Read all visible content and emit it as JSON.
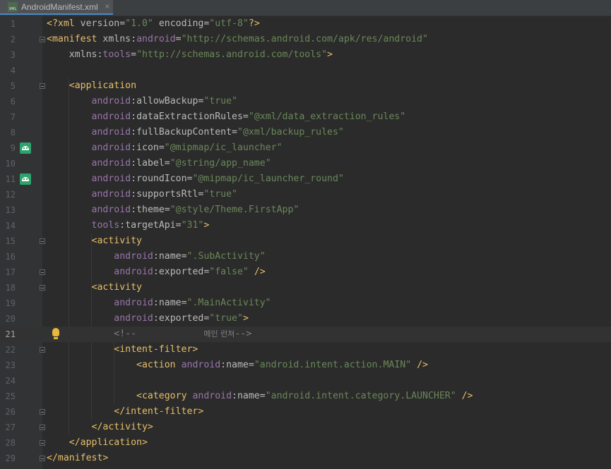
{
  "tab": {
    "icon_text": "XML",
    "filename": "AndroidManifest.xml",
    "close": "×"
  },
  "current_line": 21,
  "lines": [
    {
      "n": "1",
      "parts": [
        [
          "tag",
          "<?xml "
        ],
        [
          "att",
          "version"
        ],
        [
          "pnc",
          "="
        ],
        [
          "val",
          "\"1.0\""
        ],
        [
          "att",
          " encoding"
        ],
        [
          "pnc",
          "="
        ],
        [
          "val",
          "\"utf-8\""
        ],
        [
          "tag",
          "?>"
        ]
      ]
    },
    {
      "n": "2",
      "parts": [
        [
          "tag",
          "<manifest "
        ],
        [
          "att",
          "xmlns"
        ],
        [
          "pnc",
          ":"
        ],
        [
          "nsp",
          "android"
        ],
        [
          "pnc",
          "="
        ],
        [
          "val",
          "\"http://schemas.android.com/apk/res/android\""
        ]
      ]
    },
    {
      "n": "3",
      "parts": [
        [
          "pnc",
          "    "
        ],
        [
          "att",
          "xmlns"
        ],
        [
          "pnc",
          ":"
        ],
        [
          "nsp",
          "tools"
        ],
        [
          "pnc",
          "="
        ],
        [
          "val",
          "\"http://schemas.android.com/tools\""
        ],
        [
          "tag",
          ">"
        ]
      ]
    },
    {
      "n": "4",
      "parts": []
    },
    {
      "n": "5",
      "parts": [
        [
          "pnc",
          "    "
        ],
        [
          "tag",
          "<application"
        ]
      ]
    },
    {
      "n": "6",
      "parts": [
        [
          "pnc",
          "        "
        ],
        [
          "nsp",
          "android"
        ],
        [
          "pnc",
          ":"
        ],
        [
          "att",
          "allowBackup"
        ],
        [
          "pnc",
          "="
        ],
        [
          "val",
          "\"true\""
        ]
      ]
    },
    {
      "n": "7",
      "parts": [
        [
          "pnc",
          "        "
        ],
        [
          "nsp",
          "android"
        ],
        [
          "pnc",
          ":"
        ],
        [
          "att",
          "dataExtractionRules"
        ],
        [
          "pnc",
          "="
        ],
        [
          "val",
          "\"@xml/data_extraction_rules\""
        ]
      ]
    },
    {
      "n": "8",
      "parts": [
        [
          "pnc",
          "        "
        ],
        [
          "nsp",
          "android"
        ],
        [
          "pnc",
          ":"
        ],
        [
          "att",
          "fullBackupContent"
        ],
        [
          "pnc",
          "="
        ],
        [
          "val",
          "\"@xml/backup_rules\""
        ]
      ]
    },
    {
      "n": "9",
      "parts": [
        [
          "pnc",
          "        "
        ],
        [
          "nsp",
          "android"
        ],
        [
          "pnc",
          ":"
        ],
        [
          "att",
          "icon"
        ],
        [
          "pnc",
          "="
        ],
        [
          "val",
          "\"@mipmap/ic_launcher\""
        ]
      ]
    },
    {
      "n": "10",
      "parts": [
        [
          "pnc",
          "        "
        ],
        [
          "nsp",
          "android"
        ],
        [
          "pnc",
          ":"
        ],
        [
          "att",
          "label"
        ],
        [
          "pnc",
          "="
        ],
        [
          "val",
          "\"@string/app_name\""
        ]
      ]
    },
    {
      "n": "11",
      "parts": [
        [
          "pnc",
          "        "
        ],
        [
          "nsp",
          "android"
        ],
        [
          "pnc",
          ":"
        ],
        [
          "att",
          "roundIcon"
        ],
        [
          "pnc",
          "="
        ],
        [
          "val",
          "\"@mipmap/ic_launcher_round\""
        ]
      ]
    },
    {
      "n": "12",
      "parts": [
        [
          "pnc",
          "        "
        ],
        [
          "nsp",
          "android"
        ],
        [
          "pnc",
          ":"
        ],
        [
          "att",
          "supportsRtl"
        ],
        [
          "pnc",
          "="
        ],
        [
          "val",
          "\"true\""
        ]
      ]
    },
    {
      "n": "13",
      "parts": [
        [
          "pnc",
          "        "
        ],
        [
          "nsp",
          "android"
        ],
        [
          "pnc",
          ":"
        ],
        [
          "att",
          "theme"
        ],
        [
          "pnc",
          "="
        ],
        [
          "val",
          "\"@style/Theme.FirstApp\""
        ]
      ]
    },
    {
      "n": "14",
      "parts": [
        [
          "pnc",
          "        "
        ],
        [
          "nsp",
          "tools"
        ],
        [
          "pnc",
          ":"
        ],
        [
          "att",
          "targetApi"
        ],
        [
          "pnc",
          "="
        ],
        [
          "val",
          "\"31\""
        ],
        [
          "tag",
          ">"
        ]
      ]
    },
    {
      "n": "15",
      "parts": [
        [
          "pnc",
          "        "
        ],
        [
          "tag",
          "<activity"
        ]
      ]
    },
    {
      "n": "16",
      "parts": [
        [
          "pnc",
          "            "
        ],
        [
          "nsp",
          "android"
        ],
        [
          "pnc",
          ":"
        ],
        [
          "att",
          "name"
        ],
        [
          "pnc",
          "="
        ],
        [
          "val",
          "\".SubActivity\""
        ]
      ]
    },
    {
      "n": "17",
      "parts": [
        [
          "pnc",
          "            "
        ],
        [
          "nsp",
          "android"
        ],
        [
          "pnc",
          ":"
        ],
        [
          "att",
          "exported"
        ],
        [
          "pnc",
          "="
        ],
        [
          "val",
          "\"false\""
        ],
        [
          "tag",
          " />"
        ]
      ]
    },
    {
      "n": "18",
      "parts": [
        [
          "pnc",
          "        "
        ],
        [
          "tag",
          "<activity"
        ]
      ]
    },
    {
      "n": "19",
      "parts": [
        [
          "pnc",
          "            "
        ],
        [
          "nsp",
          "android"
        ],
        [
          "pnc",
          ":"
        ],
        [
          "att",
          "name"
        ],
        [
          "pnc",
          "="
        ],
        [
          "val",
          "\".MainActivity\""
        ]
      ]
    },
    {
      "n": "20",
      "parts": [
        [
          "pnc",
          "            "
        ],
        [
          "nsp",
          "android"
        ],
        [
          "pnc",
          ":"
        ],
        [
          "att",
          "exported"
        ],
        [
          "pnc",
          "="
        ],
        [
          "val",
          "\"true\""
        ],
        [
          "tag",
          ">"
        ]
      ]
    },
    {
      "n": "21",
      "parts": [
        [
          "pnc",
          "            "
        ],
        [
          "cmt",
          "<!--            "
        ],
        [
          "kr",
          "메인 런쳐"
        ],
        [
          "cmt",
          "-->"
        ]
      ]
    },
    {
      "n": "22",
      "parts": [
        [
          "pnc",
          "            "
        ],
        [
          "tag",
          "<intent-filter>"
        ]
      ]
    },
    {
      "n": "23",
      "parts": [
        [
          "pnc",
          "                "
        ],
        [
          "tag",
          "<action "
        ],
        [
          "nsp",
          "android"
        ],
        [
          "pnc",
          ":"
        ],
        [
          "att",
          "name"
        ],
        [
          "pnc",
          "="
        ],
        [
          "val",
          "\"android.intent.action.MAIN\""
        ],
        [
          "tag",
          " />"
        ]
      ]
    },
    {
      "n": "24",
      "parts": []
    },
    {
      "n": "25",
      "parts": [
        [
          "pnc",
          "                "
        ],
        [
          "tag",
          "<category "
        ],
        [
          "nsp",
          "android"
        ],
        [
          "pnc",
          ":"
        ],
        [
          "att",
          "name"
        ],
        [
          "pnc",
          "="
        ],
        [
          "val",
          "\"android.intent.category.LAUNCHER\""
        ],
        [
          "tag",
          " />"
        ]
      ]
    },
    {
      "n": "26",
      "parts": [
        [
          "pnc",
          "            "
        ],
        [
          "tag",
          "</intent-filter>"
        ]
      ]
    },
    {
      "n": "27",
      "parts": [
        [
          "pnc",
          "        "
        ],
        [
          "tag",
          "</activity>"
        ]
      ]
    },
    {
      "n": "28",
      "parts": [
        [
          "pnc",
          "    "
        ],
        [
          "tag",
          "</application>"
        ]
      ]
    },
    {
      "n": "29",
      "parts": [
        [
          "tag",
          "</manifest>"
        ]
      ]
    }
  ],
  "gutter_markers": {
    "android_icon_lines": [
      "9",
      "11"
    ],
    "fold_open_lines": [
      "2",
      "5",
      "15",
      "18",
      "22"
    ],
    "fold_close_lines": [
      "17",
      "26",
      "27",
      "28",
      "29"
    ],
    "bulb_line": "21"
  },
  "colors": {
    "background": "#2b2b2b",
    "tag": "#e8bf6a",
    "namespace": "#9876aa",
    "attribute": "#bababa",
    "value": "#6a8759",
    "comment": "#808080"
  }
}
